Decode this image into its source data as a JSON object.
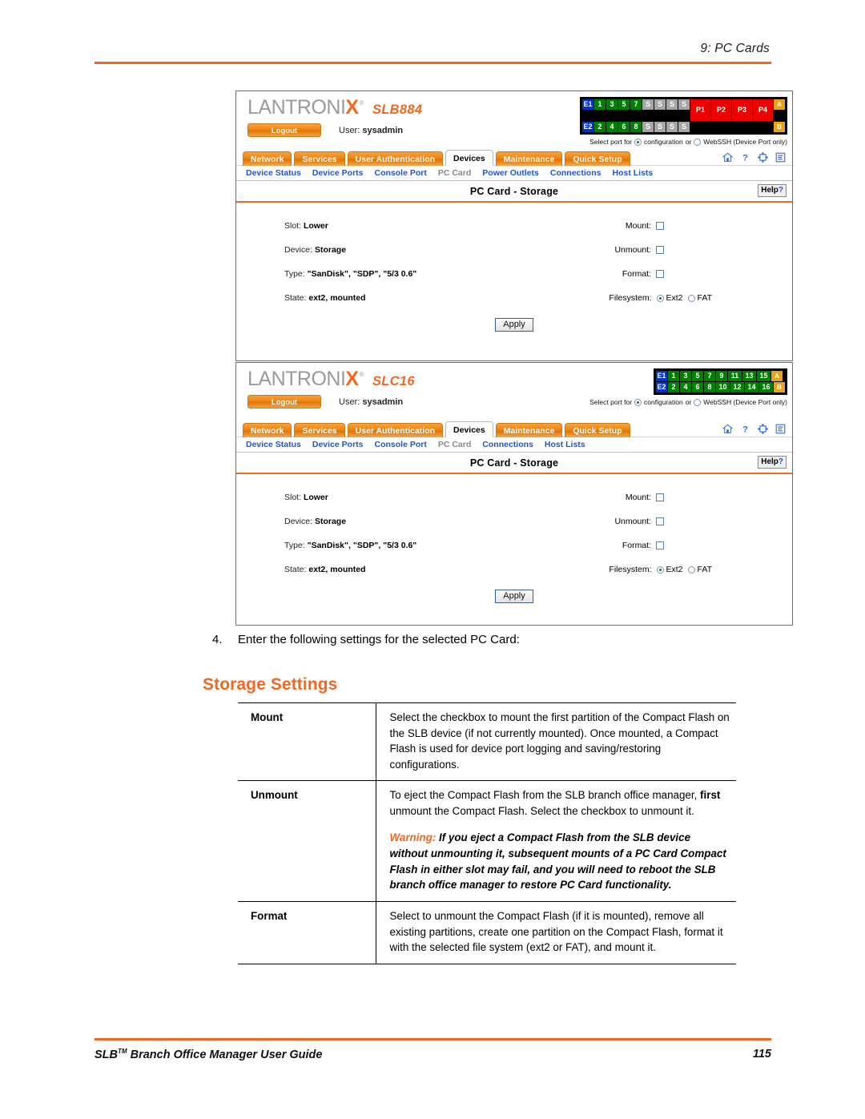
{
  "page": {
    "running_head": "9: PC Cards",
    "footer_title": "SLB",
    "footer_title_sup": "TM",
    "footer_title_rest": " Branch Office Manager User Guide",
    "page_number": "115"
  },
  "shots": [
    {
      "id": "slb884",
      "logo_word": "LANTRONI",
      "logo_x": "X",
      "logo_reg": "®",
      "model": "SLB884",
      "logout_label": "Logout",
      "user_label": "User:",
      "user_name": "sysadmin",
      "portmap": {
        "row1": [
          {
            "text": "E1",
            "style": "e"
          },
          {
            "text": "1",
            "style": "g"
          },
          {
            "text": "3",
            "style": "g"
          },
          {
            "text": "5",
            "style": "g"
          },
          {
            "text": "7",
            "style": "g"
          },
          {
            "text": "S",
            "style": "s"
          },
          {
            "text": "S",
            "style": "s"
          },
          {
            "text": "S",
            "style": "s"
          },
          {
            "text": "S",
            "style": "s"
          },
          {
            "text": "P1",
            "style": "r"
          },
          {
            "text": "P2",
            "style": "r"
          },
          {
            "text": "P3",
            "style": "r"
          },
          {
            "text": "P4",
            "style": "r"
          },
          {
            "text": "A",
            "style": "ab"
          }
        ],
        "row2": [
          {
            "text": "E2",
            "style": "e"
          },
          {
            "text": "2",
            "style": "g"
          },
          {
            "text": "4",
            "style": "g"
          },
          {
            "text": "6",
            "style": "g"
          },
          {
            "text": "8",
            "style": "g"
          },
          {
            "text": "S",
            "style": "s"
          },
          {
            "text": "S",
            "style": "s"
          },
          {
            "text": "S",
            "style": "s"
          },
          {
            "text": "S",
            "style": "s"
          },
          {
            "text": "",
            "style": "r"
          },
          {
            "text": "",
            "style": "r"
          },
          {
            "text": "",
            "style": "r"
          },
          {
            "text": "",
            "style": "r"
          },
          {
            "text": "B",
            "style": "ab"
          }
        ],
        "merge_p": true
      },
      "select_port": {
        "prefix": "Select port for",
        "option1": "configuration",
        "conj": "or",
        "option2": "WebSSH (Device Port only)",
        "selected": "configuration"
      },
      "tabs": [
        {
          "label": "Network",
          "active": false
        },
        {
          "label": "Services",
          "active": false
        },
        {
          "label": "User Authentication",
          "active": false
        },
        {
          "label": "Devices",
          "active": true
        },
        {
          "label": "Maintenance",
          "active": false
        },
        {
          "label": "Quick Setup",
          "active": false
        }
      ],
      "tool_icons": [
        "home-icon",
        "help-question-icon",
        "expand-icon",
        "list-icon"
      ],
      "subnav": [
        {
          "label": "Device Status",
          "current": false
        },
        {
          "label": "Device Ports",
          "current": false
        },
        {
          "label": "Console Port",
          "current": false
        },
        {
          "label": "PC Card",
          "current": true
        },
        {
          "label": "Power Outlets",
          "current": false
        },
        {
          "label": "Connections",
          "current": false
        },
        {
          "label": "Host Lists",
          "current": false
        }
      ],
      "panel": {
        "title": "PC Card - Storage",
        "help_label": "Help",
        "help_mark": "?",
        "fields": [
          {
            "label": "Slot:",
            "value": "Lower"
          },
          {
            "label": "Device:",
            "value": "Storage"
          },
          {
            "label": "Type:",
            "value": "\"SanDisk\", \"SDP\", \"5/3 0.6\""
          },
          {
            "label": "State:",
            "value": "ext2, mounted"
          }
        ],
        "checkboxes": [
          {
            "label": "Mount:",
            "checked": false
          },
          {
            "label": "Unmount:",
            "checked": false
          },
          {
            "label": "Format:",
            "checked": false
          }
        ],
        "filesystem": {
          "label": "Filesystem:",
          "options": [
            "Ext2",
            "FAT"
          ],
          "selected": "Ext2"
        },
        "apply_label": "Apply"
      }
    },
    {
      "id": "slc16",
      "logo_word": "LANTRONI",
      "logo_x": "X",
      "logo_reg": "®",
      "model": "SLC16",
      "logout_label": "Logout",
      "user_label": "User:",
      "user_name": "sysadmin",
      "portmap": {
        "row1": [
          {
            "text": "E1",
            "style": "e"
          },
          {
            "text": "1",
            "style": "g"
          },
          {
            "text": "3",
            "style": "g"
          },
          {
            "text": "5",
            "style": "g"
          },
          {
            "text": "7",
            "style": "g"
          },
          {
            "text": "9",
            "style": "g"
          },
          {
            "text": "11",
            "style": "g w2"
          },
          {
            "text": "13",
            "style": "g w2"
          },
          {
            "text": "15",
            "style": "g w2"
          },
          {
            "text": "A",
            "style": "ab"
          }
        ],
        "row2": [
          {
            "text": "E2",
            "style": "e"
          },
          {
            "text": "2",
            "style": "g"
          },
          {
            "text": "4",
            "style": "g"
          },
          {
            "text": "6",
            "style": "g"
          },
          {
            "text": "8",
            "style": "g"
          },
          {
            "text": "10",
            "style": "g w2"
          },
          {
            "text": "12",
            "style": "g w2"
          },
          {
            "text": "14",
            "style": "g w2"
          },
          {
            "text": "16",
            "style": "g w2"
          },
          {
            "text": "B",
            "style": "ab"
          }
        ],
        "merge_p": false
      },
      "select_port": {
        "prefix": "Select port for",
        "option1": "configuration",
        "conj": "or",
        "option2": "WebSSH (Device Port only)",
        "selected": "configuration"
      },
      "tabs": [
        {
          "label": "Network",
          "active": false
        },
        {
          "label": "Services",
          "active": false
        },
        {
          "label": "User Authentication",
          "active": false
        },
        {
          "label": "Devices",
          "active": true
        },
        {
          "label": "Maintenance",
          "active": false
        },
        {
          "label": "Quick Setup",
          "active": false
        }
      ],
      "tool_icons": [
        "home-icon",
        "help-question-icon",
        "expand-icon",
        "list-icon"
      ],
      "subnav": [
        {
          "label": "Device Status",
          "current": false
        },
        {
          "label": "Device Ports",
          "current": false
        },
        {
          "label": "Console Port",
          "current": false
        },
        {
          "label": "PC Card",
          "current": true
        },
        {
          "label": "Connections",
          "current": false
        },
        {
          "label": "Host Lists",
          "current": false
        }
      ],
      "panel": {
        "title": "PC Card - Storage",
        "help_label": "Help",
        "help_mark": "?",
        "fields": [
          {
            "label": "Slot:",
            "value": "Lower"
          },
          {
            "label": "Device:",
            "value": "Storage"
          },
          {
            "label": "Type:",
            "value": "\"SanDisk\", \"SDP\", \"5/3 0.6\""
          },
          {
            "label": "State:",
            "value": "ext2, mounted"
          }
        ],
        "checkboxes": [
          {
            "label": "Mount:",
            "checked": false
          },
          {
            "label": "Unmount:",
            "checked": false
          },
          {
            "label": "Format:",
            "checked": false
          }
        ],
        "filesystem": {
          "label": "Filesystem:",
          "options": [
            "Ext2",
            "FAT"
          ],
          "selected": "Ext2"
        },
        "apply_label": "Apply"
      }
    }
  ],
  "step": {
    "number": "4.",
    "text": "Enter the following settings for the selected PC Card:"
  },
  "section_title": "Storage Settings",
  "settings": [
    {
      "name": "Mount",
      "desc": "Select the checkbox to mount the first partition of the Compact Flash on the SLB device (if not currently mounted). Once mounted, a Compact Flash is used for device port logging and saving/restoring configurations.",
      "warning": null
    },
    {
      "name": "Unmount",
      "desc_parts": [
        "To eject the Compact Flash from the SLB branch office manager, ",
        "first",
        " unmount the Compact Flash. Select the checkbox to unmount it."
      ],
      "warning_label": "Warning:",
      "warning": " If you eject a Compact Flash from the SLB device without unmounting it, subsequent mounts of a PC Card Compact Flash in either slot may fail, and you will need to reboot the SLB branch office manager to restore PC Card functionality."
    },
    {
      "name": "Format",
      "desc": "Select to unmount the Compact Flash (if it is mounted), remove all existing partitions, create one partition on the Compact Flash, format it with the selected file system (ext2 or FAT), and mount it.",
      "warning": null
    }
  ],
  "colors": {
    "accent_orange": "#F26722",
    "link_blue": "#2255CC",
    "port_green": "#008000",
    "port_blue": "#0033CC",
    "port_red": "#EE0000",
    "port_gray": "#A6A6A6",
    "port_amber": "#E8A317"
  }
}
